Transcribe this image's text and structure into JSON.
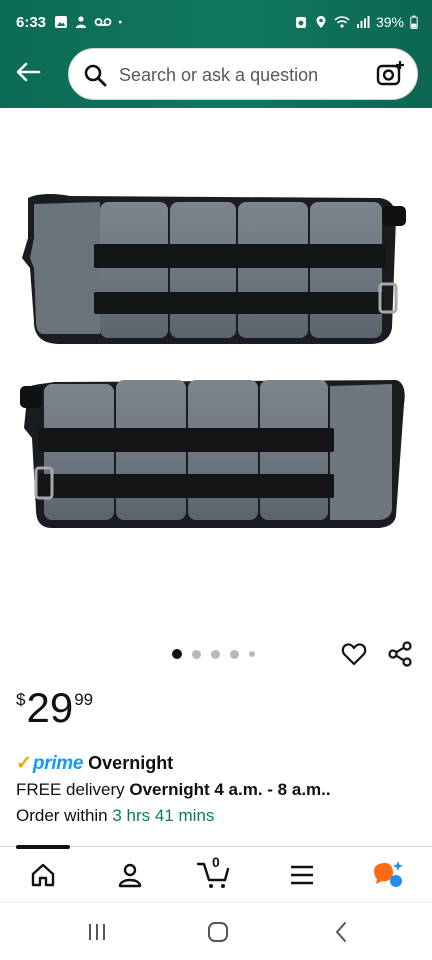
{
  "status_bar": {
    "time": "6:33",
    "battery": "39%",
    "left_icons": [
      "image-icon",
      "person-icon",
      "voicemail-icon",
      "dot-icon"
    ],
    "right_icons": [
      "alarm-icon",
      "location-icon",
      "wifi-icon",
      "signal-icon",
      "battery-icon"
    ]
  },
  "header": {
    "back_icon": "arrow-left-icon",
    "search_placeholder": "Search or ask a question",
    "camera_icon": "camera-plus-icon",
    "brand_color": "#11785f"
  },
  "product": {
    "image_description_icon": "ankle-weights-image",
    "pager": {
      "count": 5,
      "active_index": 0
    },
    "wishlist_icon": "heart-icon",
    "share_icon": "share-icon"
  },
  "price": {
    "symbol": "$",
    "whole": "29",
    "fraction": "99"
  },
  "prime": {
    "check": "✓",
    "logo": "prime",
    "speed": "Overnight"
  },
  "delivery": {
    "prefix": "FREE delivery ",
    "window": "Overnight 4 a.m. - 8 a.m.",
    "suffix": "."
  },
  "order": {
    "prefix": "Order within ",
    "countdown": "3 hrs 41 mins",
    "countdown_color": "#067d62"
  },
  "bottom_nav": {
    "items": [
      "home-icon",
      "account-icon",
      "cart-icon",
      "menu-icon",
      "rufus-icon"
    ],
    "cart_count": "0",
    "active": "home"
  },
  "system_nav": {
    "items": [
      "recents-icon",
      "home-icon",
      "back-icon"
    ]
  }
}
